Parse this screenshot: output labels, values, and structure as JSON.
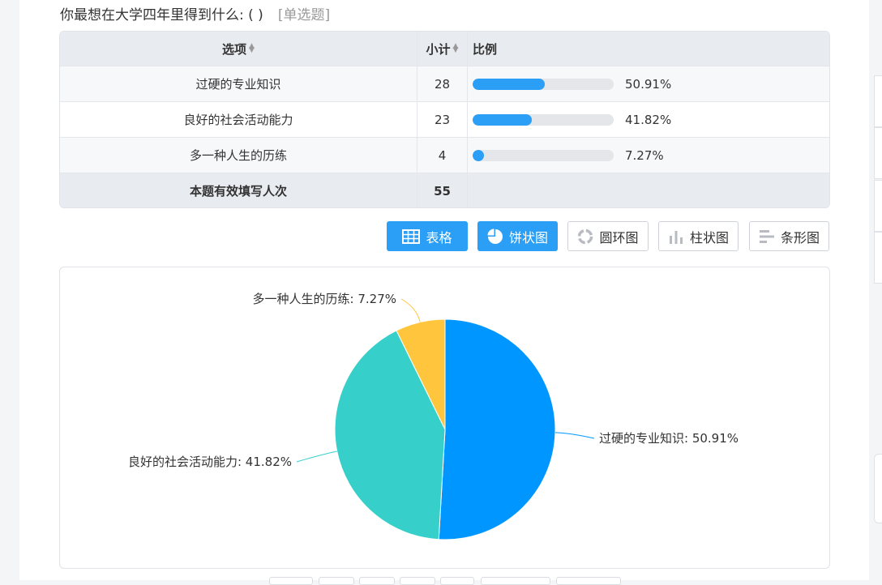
{
  "question": {
    "text": "你最想在大学四年里得到什么: ( )",
    "type": "[单选题]"
  },
  "table": {
    "headers": {
      "option": "选项",
      "count": "小计",
      "ratio": "比例"
    },
    "rows": [
      {
        "option": "过硬的专业知识",
        "count": "28",
        "percent": "50.91%",
        "fraction": 0.5091
      },
      {
        "option": "良好的社会活动能力",
        "count": "23",
        "percent": "41.82%",
        "fraction": 0.4182
      },
      {
        "option": "多一种人生的历练",
        "count": "4",
        "percent": "7.27%",
        "fraction": 0.0727
      }
    ],
    "total": {
      "label": "本题有效填写人次",
      "count": "55"
    }
  },
  "toolbar": {
    "buttons": [
      {
        "label": "表格",
        "icon": "table-icon",
        "active": true
      },
      {
        "label": "饼状图",
        "icon": "pie-chart-icon",
        "active": true
      },
      {
        "label": "圆环图",
        "icon": "donut-chart-icon",
        "active": false
      },
      {
        "label": "柱状图",
        "icon": "bar-chart-icon",
        "active": false
      },
      {
        "label": "条形图",
        "icon": "horizontal-bar-chart-icon",
        "active": false
      }
    ]
  },
  "chart_data": {
    "type": "pie",
    "categories": [
      "过硬的专业知识",
      "良好的社会活动能力",
      "多一种人生的历练"
    ],
    "values": [
      50.91,
      41.82,
      7.27
    ],
    "labels": [
      "过硬的专业知识: 50.91%",
      "良好的社会活动能力: 41.82%",
      "多一种人生的历练: 7.27%"
    ],
    "colors": [
      "#0096ff",
      "#36cfc9",
      "#ffc53d"
    ],
    "title": ""
  },
  "colors": {
    "accent": "#2a9ff5",
    "bar_fill": "#2a9ff5",
    "bar_track": "#e4e6ea"
  }
}
